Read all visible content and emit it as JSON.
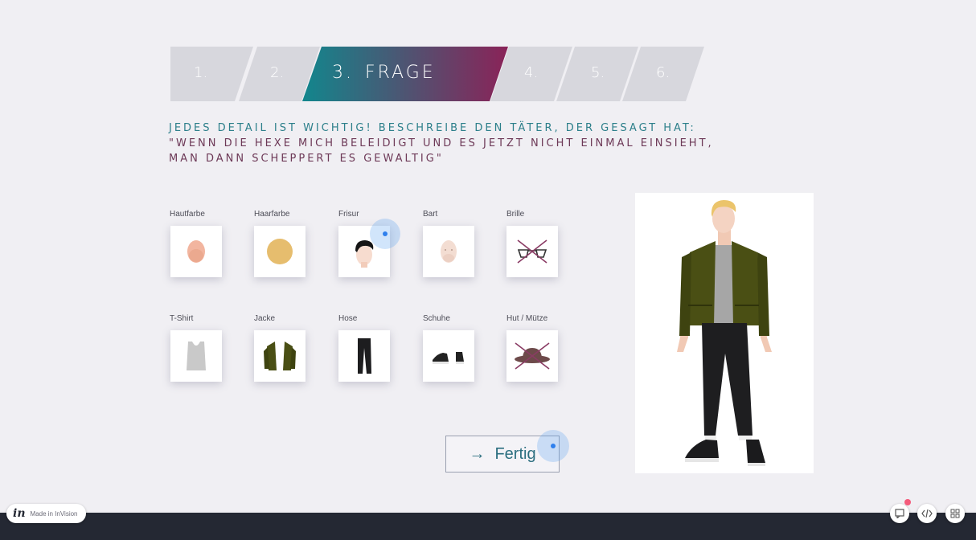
{
  "steps": [
    {
      "label": "1."
    },
    {
      "label": "2."
    },
    {
      "label": "3.",
      "title": "FRAGE",
      "active": true
    },
    {
      "label": "4."
    },
    {
      "label": "5."
    },
    {
      "label": "6."
    }
  ],
  "question": {
    "line1": "JEDES DETAIL IST WICHTIG! BESCHREIBE DEN TÄTER, DER GESAGT HAT:",
    "line2": "\"WENN DIE HEXE MICH BELEIDIGT UND ES JETZT NICHT EINMAL EINSIEHT,",
    "line3": "MAN DANN SCHEPPERT ES GEWALTIG\""
  },
  "items_row1": [
    {
      "label": "Hautfarbe",
      "icon": "skin-color-icon"
    },
    {
      "label": "Haarfarbe",
      "icon": "hair-color-icon"
    },
    {
      "label": "Frisur",
      "icon": "hairstyle-icon"
    },
    {
      "label": "Bart",
      "icon": "beard-icon"
    },
    {
      "label": "Brille",
      "icon": "glasses-crossed-icon"
    }
  ],
  "items_row2": [
    {
      "label": "T-Shirt",
      "icon": "tshirt-icon"
    },
    {
      "label": "Jacke",
      "icon": "jacket-icon"
    },
    {
      "label": "Hose",
      "icon": "pants-icon"
    },
    {
      "label": "Schuhe",
      "icon": "shoes-icon"
    },
    {
      "label": "Hut / Mütze",
      "icon": "hat-crossed-icon"
    }
  ],
  "fertig_button": {
    "arrow": "→",
    "label": "Fertig"
  },
  "footer": {
    "badge_logo": "in",
    "badge_text": "Made in InVision"
  },
  "colors": {
    "active_step_gradient": [
      "#12868d",
      "#8a2358"
    ],
    "inactive_step": "#d7d7dd",
    "question_teal": "#2c7f8a",
    "question_plum": "#6d3957",
    "jacket": "#4a4f14",
    "hotspot": "#2f80ed"
  }
}
